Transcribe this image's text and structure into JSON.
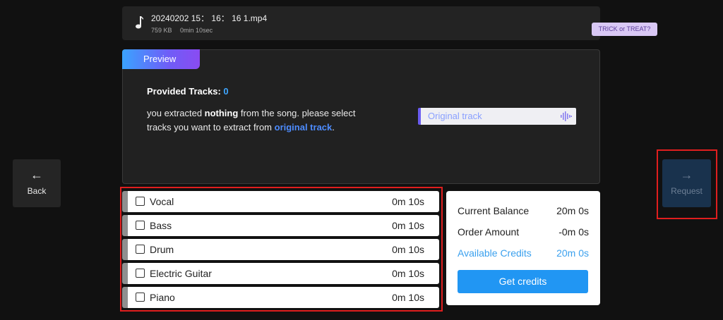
{
  "file": {
    "name": "20240202 15： 16： 16 1.mp4",
    "size": "759 KB",
    "duration": "0min 10sec"
  },
  "promo_badge": "TRICK or TREAT?",
  "preview": {
    "tab_label": "Preview",
    "provided_label": "Provided Tracks:",
    "provided_count": "0",
    "desc_part1": "you extracted ",
    "desc_bold": "nothing",
    "desc_part2": " from the song. please select tracks you want to extract from ",
    "desc_link": "original track",
    "desc_end": ".",
    "original_track_label": "Original track"
  },
  "nav": {
    "back_label": "Back",
    "request_label": "Request"
  },
  "tracks": [
    {
      "name": "Vocal",
      "duration": "0m 10s"
    },
    {
      "name": "Bass",
      "duration": "0m 10s"
    },
    {
      "name": "Drum",
      "duration": "0m 10s"
    },
    {
      "name": "Electric Guitar",
      "duration": "0m 10s"
    },
    {
      "name": "Piano",
      "duration": "0m 10s"
    }
  ],
  "summary": {
    "balance_label": "Current Balance",
    "balance_value": "20m 0s",
    "order_label": "Order Amount",
    "order_value": "-0m 0s",
    "available_label": "Available Credits",
    "available_value": "20m 0s",
    "get_credits_label": "Get credits"
  },
  "icons": {
    "file": "music-note-icon",
    "waveform": "waveform-icon",
    "back": "arrow-left-icon",
    "request": "arrow-right-icon"
  },
  "colors": {
    "accent_blue": "#2196f3",
    "link_blue": "#4d8cff",
    "highlight_red": "#e01e1e",
    "request_bg": "#19324d"
  }
}
